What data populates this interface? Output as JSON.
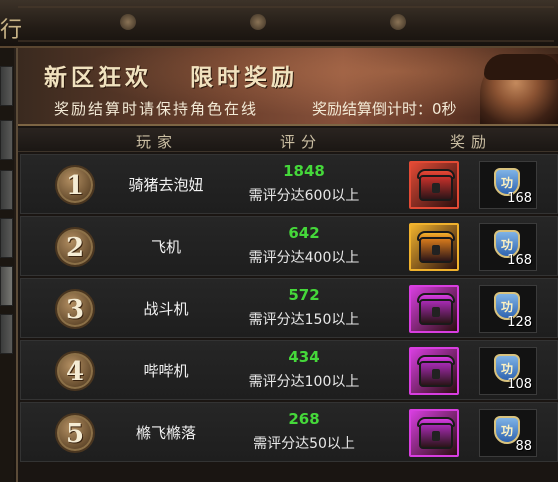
{
  "window": {
    "title_fragment": "行"
  },
  "banner": {
    "title_left": "新区狂欢",
    "title_right": "限时奖励",
    "subtitle": "奖励结算时请保持角色在线",
    "countdown": "奖励结算倒计时：0秒"
  },
  "table": {
    "headers": {
      "player": "玩家",
      "score": "评分",
      "reward": "奖励"
    },
    "rows": [
      {
        "rank": "1",
        "name": "骑猪去泡妞",
        "score": "1848",
        "requirement": "需评分达600以上",
        "chest_color": "#c8312b",
        "chest_frame": "#e24a35",
        "medal_qty": "168"
      },
      {
        "rank": "2",
        "name": "飞机",
        "score": "642",
        "requirement": "需评分达400以上",
        "chest_color": "#d67a1c",
        "chest_frame": "#f0b22d",
        "medal_qty": "168"
      },
      {
        "rank": "3",
        "name": "战斗机",
        "score": "572",
        "requirement": "需评分达150以上",
        "chest_color": "#a72bb3",
        "chest_frame": "#d83ee0",
        "medal_qty": "128"
      },
      {
        "rank": "4",
        "name": "哔哔机",
        "score": "434",
        "requirement": "需评分达100以上",
        "chest_color": "#a72bb3",
        "chest_frame": "#d83ee0",
        "medal_qty": "108"
      },
      {
        "rank": "5",
        "name": "樤飞樤落",
        "score": "268",
        "requirement": "需评分达50以上",
        "chest_color": "#a72bb3",
        "chest_frame": "#d83ee0",
        "medal_qty": "88"
      }
    ]
  },
  "medal_glyph": "功"
}
